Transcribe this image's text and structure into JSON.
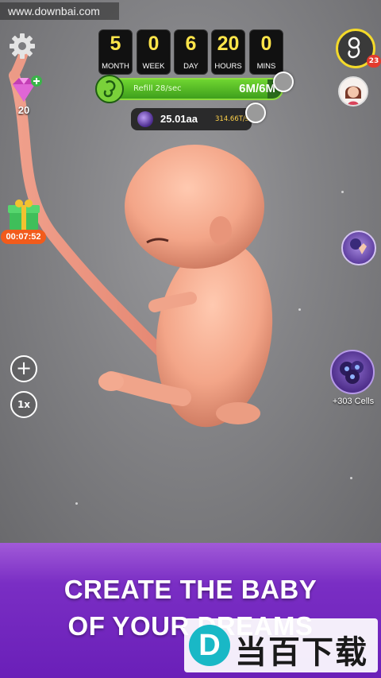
{
  "watermark_top": "www.downbai.com",
  "timer": [
    {
      "value": "5",
      "unit": "MONTH"
    },
    {
      "value": "0",
      "unit": "WEEK"
    },
    {
      "value": "6",
      "unit": "DAY"
    },
    {
      "value": "20",
      "unit": "HOURS"
    },
    {
      "value": "0",
      "unit": "MINS"
    }
  ],
  "refill": {
    "label": "Refill 28/sec",
    "amount": "6M/6M",
    "fill_fraction": 0.92
  },
  "cells_bar": {
    "value": "25.01aa",
    "rate": "314.66T/sec"
  },
  "gems": {
    "count": "20"
  },
  "gift": {
    "timer": "00:07:52"
  },
  "left_buttons": {
    "plus": "+",
    "speed": "1x"
  },
  "baby_badge": "23",
  "cells_reward": {
    "label": "+303 Cells"
  },
  "banner": {
    "line1": "CREATE THE BABY",
    "line2": "OF YOUR DREAMS"
  },
  "watermark_bottom": {
    "logo": "D",
    "text": "当百下载"
  },
  "colors": {
    "timer_digits": "#ffe54a",
    "refill_green": "#6fd531",
    "banner_purple": "#7a2ec4",
    "badge_red": "#e23b2e"
  },
  "icons": [
    "gear-icon",
    "gem-icon",
    "gift-icon",
    "plus-icon",
    "speed-icon",
    "fetus-icon",
    "avatar-icon",
    "tap-cells-icon",
    "cells-icon"
  ]
}
